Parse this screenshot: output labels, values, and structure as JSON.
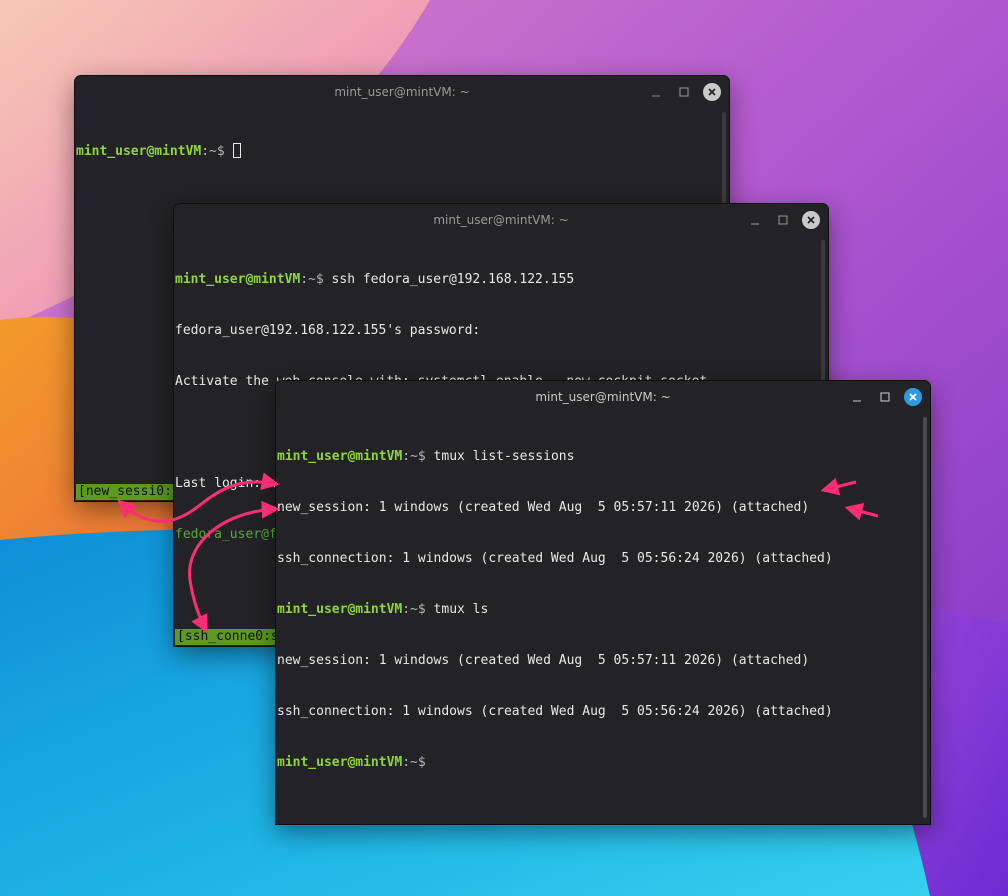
{
  "colors": {
    "prompt_user": "#8fd63b",
    "remote_prompt": "#5aa83a",
    "tmux_status": "#5d9a1f",
    "arrow": "#ff2d73",
    "close_active": "#2d9be0"
  },
  "windows": {
    "back": {
      "title": "mint_user@mintVM: ~",
      "prompt_user": "mint_user@mintVM",
      "prompt_dir": ":~$ ",
      "status": "[new_sessi0:"
    },
    "middle": {
      "title": "mint_user@mintVM: ~",
      "line1_user": "mint_user@mintVM",
      "line1_dir": ":~$ ",
      "line1_cmd": "ssh fedora_user@192.168.122.155",
      "line2": "fedora_user@192.168.122.155's password:",
      "line3": "Activate the web console with: systemctl enable --now cockpit.socket",
      "line4": "",
      "line5": "Last login: Wed Aug  5 12:40:31 2026 from 192.168.122.55",
      "line6_user": "fedora_user@fedora",
      "line6_dir": ":~$ ",
      "status": "[ssh_conne0:s"
    },
    "front": {
      "title": "mint_user@mintVM: ~",
      "l1_user": "mint_user@mintVM",
      "l1_dir": ":~$ ",
      "l1_cmd": "tmux list-sessions",
      "l2": "new_session: 1 windows (created Wed Aug  5 05:57:11 2026) (attached)",
      "l3": "ssh_connection: 1 windows (created Wed Aug  5 05:56:24 2026) (attached)",
      "l4_user": "mint_user@mintVM",
      "l4_dir": ":~$ ",
      "l4_cmd": "tmux ls",
      "l5": "new_session: 1 windows (created Wed Aug  5 05:57:11 2026) (attached)",
      "l6": "ssh_connection: 1 windows (created Wed Aug  5 05:56:24 2026) (attached)",
      "l7_user": "mint_user@mintVM",
      "l7_dir": ":~$"
    }
  },
  "icons": {
    "minimize": "minimize-icon",
    "maximize": "maximize-icon",
    "close": "close-icon"
  }
}
